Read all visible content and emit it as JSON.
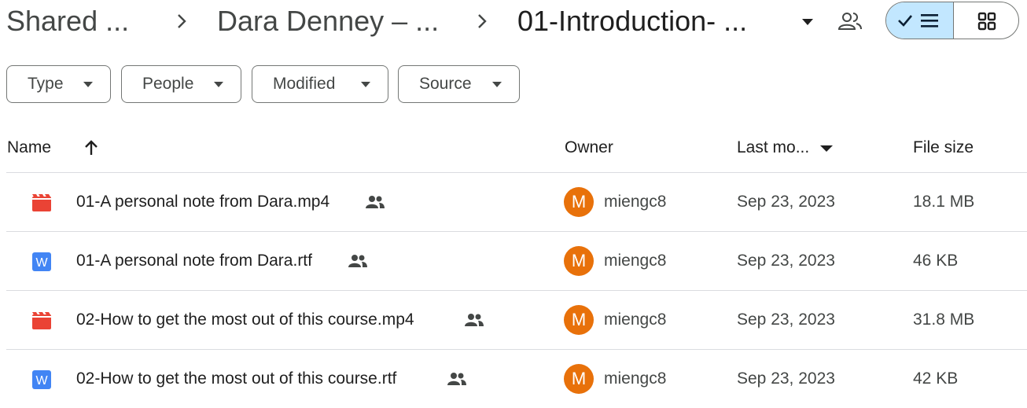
{
  "breadcrumb": {
    "items": [
      "Shared ...",
      "Dara Denney – ...",
      "01-Introduction- ..."
    ]
  },
  "view_toggle": {
    "selected": "list",
    "list_icon": "checked-list-icon",
    "grid_icon": "grid-icon"
  },
  "filters": [
    {
      "label": "Type"
    },
    {
      "label": "People"
    },
    {
      "label": "Modified"
    },
    {
      "label": "Source"
    }
  ],
  "table": {
    "columns": {
      "name": "Name",
      "owner": "Owner",
      "modified": "Last mo...",
      "size": "File size"
    },
    "sort": {
      "column": "name",
      "direction": "ascending"
    },
    "rows": [
      {
        "name": "01-A personal note from Dara.mp4",
        "icon": "video-file-icon",
        "owner_initial": "M",
        "owner": "miengc8",
        "modified": "Sep 23, 2023",
        "size": "18.1 MB"
      },
      {
        "name": "01-A personal note from Dara.rtf",
        "icon": "word-file-icon",
        "icon_letter": "W",
        "owner_initial": "M",
        "owner": "miengc8",
        "modified": "Sep 23, 2023",
        "size": "46 KB"
      },
      {
        "name": "02-How to get the most out of this course.mp4",
        "icon": "video-file-icon",
        "owner_initial": "M",
        "owner": "miengc8",
        "modified": "Sep 23, 2023",
        "size": "31.8 MB"
      },
      {
        "name": "02-How to get the most out of this course.rtf",
        "icon": "word-file-icon",
        "icon_letter": "W",
        "owner_initial": "M",
        "owner": "miengc8",
        "modified": "Sep 23, 2023",
        "size": "42 KB"
      }
    ]
  },
  "colors": {
    "video_icon": "#ea4335",
    "word_icon": "#4285f4",
    "avatar": "#e8710a",
    "view_toggle_selected": "#c2e7ff"
  }
}
